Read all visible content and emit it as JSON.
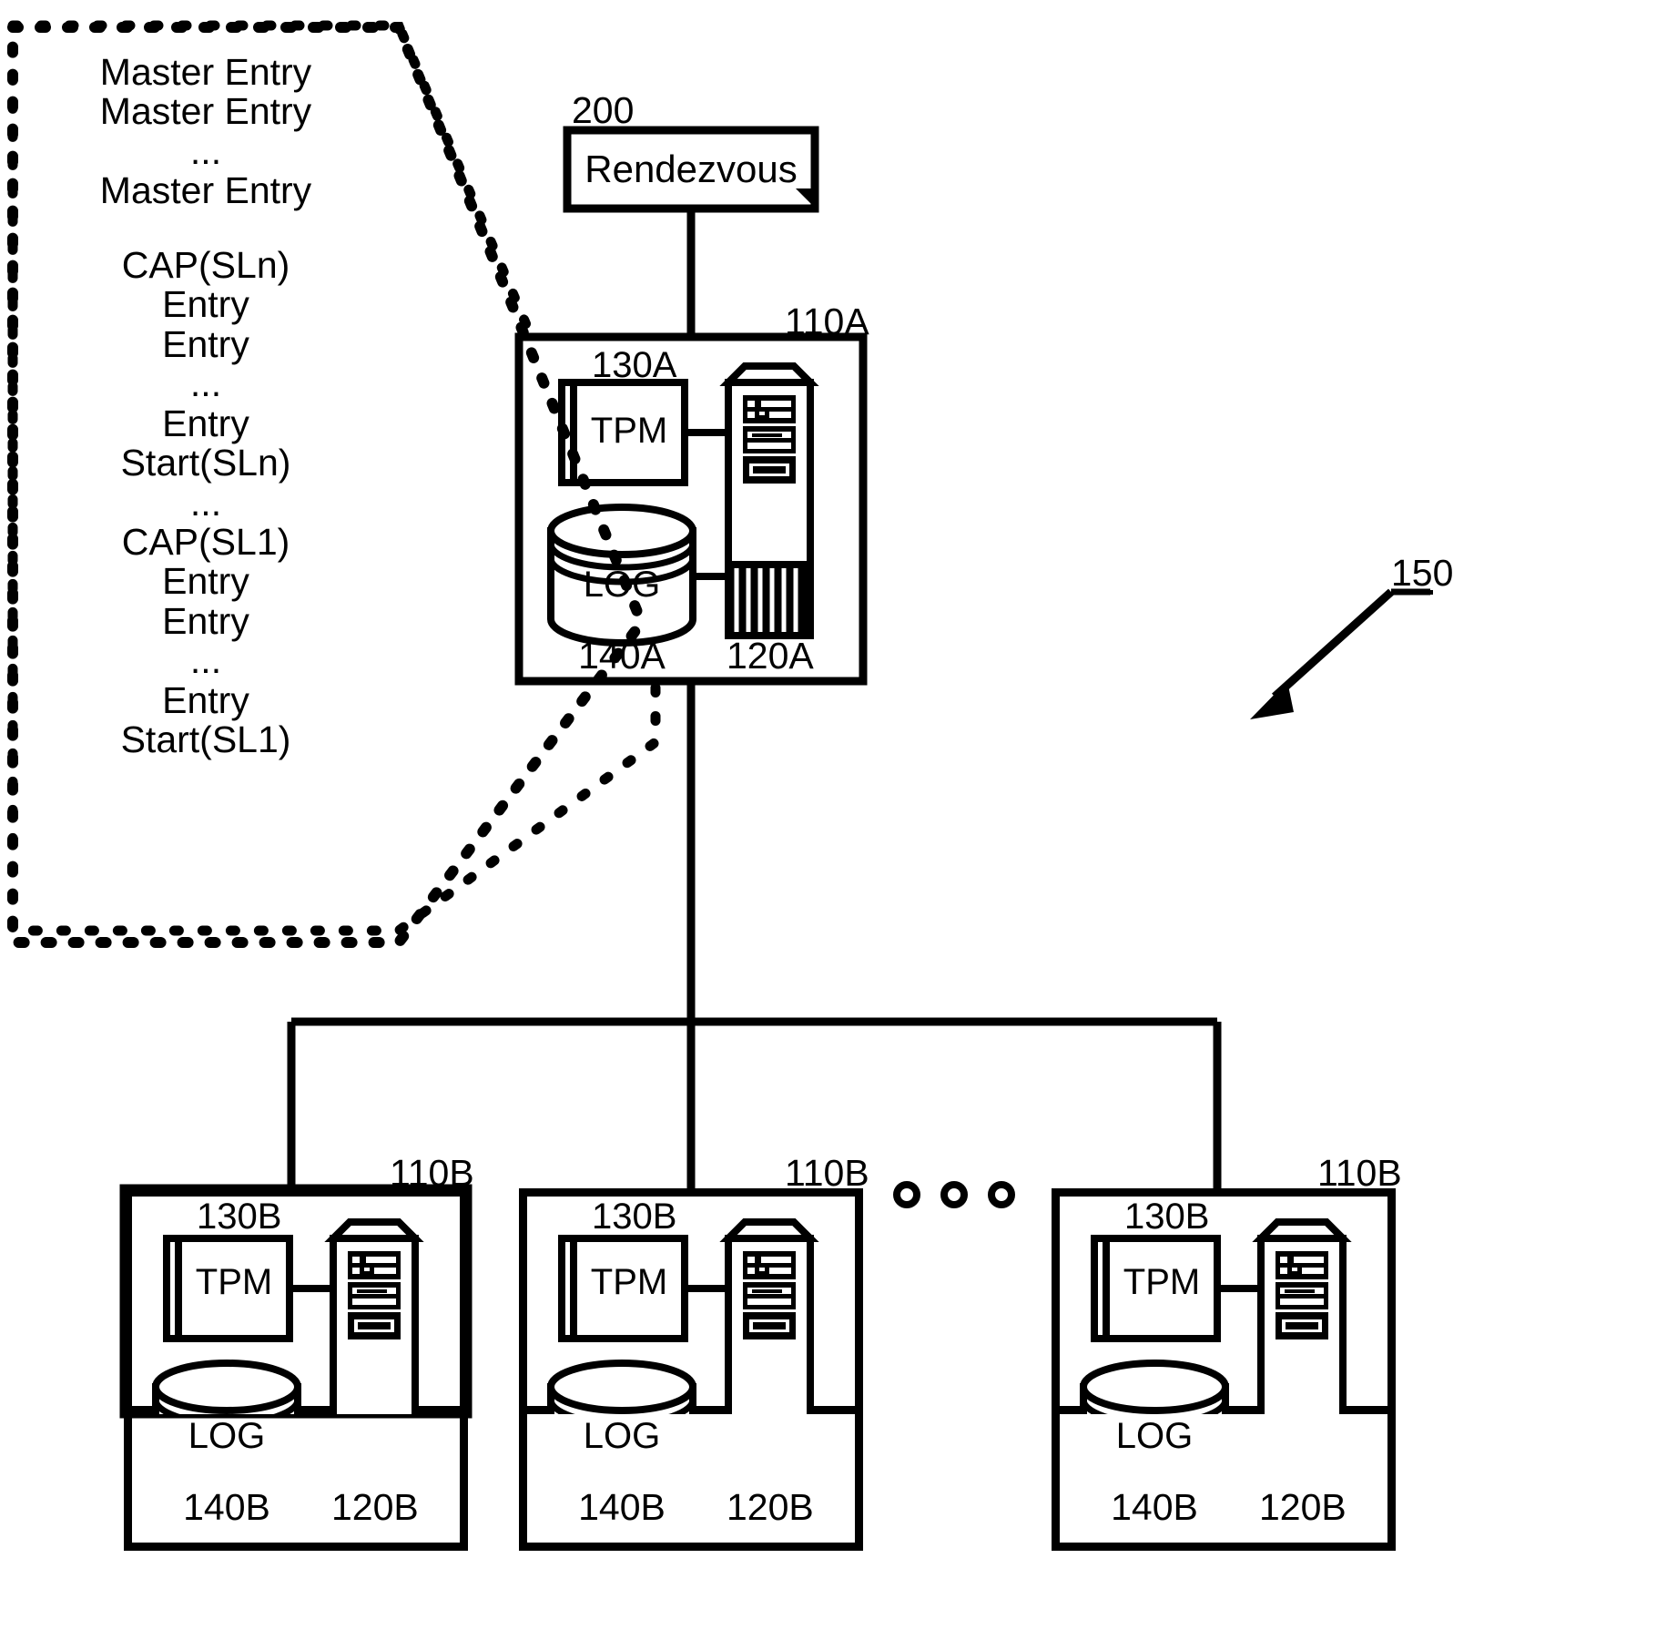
{
  "figure": {
    "type": "patent-system-diagram",
    "background_color": "#ffffff",
    "stroke_color": "#000000"
  },
  "callout": {
    "name": "log-contents-callout",
    "shape": "dashed-polygon-pointer",
    "lines": [
      "Master Entry",
      "Master Entry",
      "...",
      "Master Entry",
      "",
      "CAP(SLn)",
      "Entry",
      "Entry",
      "...",
      "Entry",
      "Start(SLn)",
      "...",
      "CAP(SL1)",
      "Entry",
      "Entry",
      "...",
      "Entry",
      "Start(SL1)"
    ]
  },
  "rendezvous": {
    "ref": "200",
    "label": "Rendezvous"
  },
  "primary_node": {
    "ref": "110A",
    "tpm": {
      "ref": "130A",
      "label": "TPM"
    },
    "log": {
      "ref": "140A",
      "label": "LOG"
    },
    "server": {
      "ref": "120A",
      "label": ""
    }
  },
  "system_ref": {
    "ref": "150"
  },
  "secondary_nodes": [
    {
      "ref": "110B",
      "tpm": {
        "ref": "130B",
        "label": "TPM"
      },
      "log": {
        "ref": "140B",
        "label": "LOG"
      },
      "server": {
        "ref": "120B",
        "label": ""
      }
    },
    {
      "ref": "110B",
      "tpm": {
        "ref": "130B",
        "label": "TPM"
      },
      "log": {
        "ref": "140B",
        "label": "LOG"
      },
      "server": {
        "ref": "120B",
        "label": ""
      }
    },
    {
      "ref": "110B",
      "tpm": {
        "ref": "130B",
        "label": "TPM"
      },
      "log": {
        "ref": "140B",
        "label": "LOG"
      },
      "server": {
        "ref": "120B",
        "label": ""
      }
    }
  ],
  "ellipsis": {
    "name": "more-nodes-ellipsis",
    "dot_count": 3
  }
}
